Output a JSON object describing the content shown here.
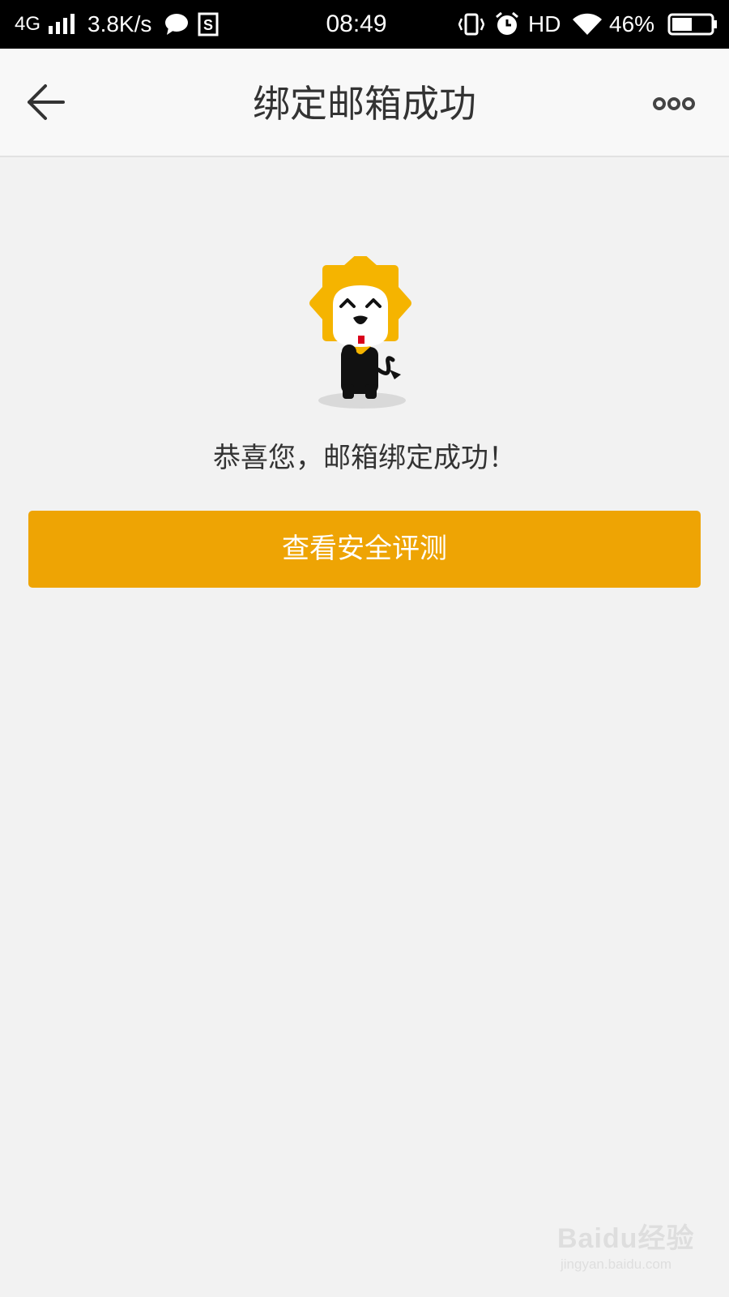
{
  "status_bar": {
    "network": "4G",
    "speed": "3.8K/s",
    "time": "08:49",
    "hd": "HD",
    "battery": "46%"
  },
  "nav": {
    "title": "绑定邮箱成功"
  },
  "content": {
    "message": "恭喜您，邮箱绑定成功！",
    "button_label": "查看安全评测"
  },
  "colors": {
    "accent": "#eea404",
    "background": "#f2f2f2",
    "mascot": "#f5b400"
  },
  "watermark": {
    "brand": "Baidu经验",
    "url": "jingyan.baidu.com"
  }
}
